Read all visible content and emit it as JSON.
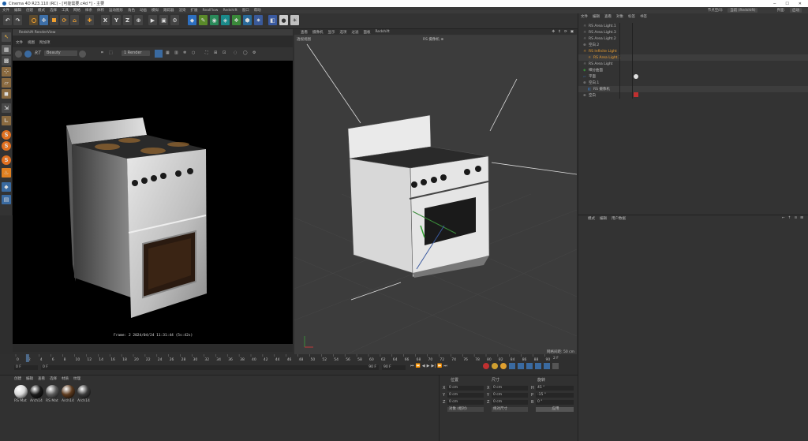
{
  "window": {
    "title": "Cinema 4D R23.110 (RC) - [可能需要.c4d *] - 主要"
  },
  "menubar": {
    "items": [
      "文件",
      "编辑",
      "创建",
      "模式",
      "选择",
      "工具",
      "网格",
      "样条",
      "体积",
      "运动图形",
      "角色",
      "动画",
      "模拟",
      "跟踪器",
      "渲染",
      "扩展",
      "RealFlow",
      "Redshift",
      "窗口",
      "帮助"
    ],
    "right": {
      "node_label": "节点空间:",
      "node_value": "当前 (Redshift)",
      "layout_label": "界面:",
      "layout_value": "启动"
    }
  },
  "toolbar": {
    "labels": [
      "X",
      "Y",
      "Z"
    ]
  },
  "renderview": {
    "title": "Redshift RenderView",
    "menu": [
      "文件",
      "视图",
      "附加项"
    ],
    "rt_label": "RT",
    "beauty": "Beauty",
    "camera": "1 Render",
    "status": "Frame: 2  2024/04/24  11:31:44  (5s:42s)"
  },
  "viewport": {
    "menu": [
      "查看",
      "摄像机",
      "显示",
      "选项",
      "过滤",
      "面板",
      "Redshift"
    ],
    "view_name": "透视视图",
    "camera_tag": "RS 摄像机 ⊕",
    "grid_spacing": "网格间距: 50 cm"
  },
  "objects": {
    "menu": [
      "文件",
      "编辑",
      "查看",
      "对象",
      "标签",
      "书签"
    ],
    "rows": [
      {
        "name": "RS Area Light.1",
        "color": "#c8c8c8"
      },
      {
        "name": "RS Area Light.3",
        "color": "#c8c8c8"
      },
      {
        "name": "RS Area Light.2",
        "color": "#c8c8c8"
      },
      {
        "name": "空白.2",
        "color": "#c8c8c8"
      },
      {
        "name": "RS Infinite Light",
        "color": "#f0a030"
      },
      {
        "name": "RS Area Light.1",
        "color": "#f0a030"
      },
      {
        "name": "RS Area Light",
        "color": "#c8c8c8"
      },
      {
        "name": "细分曲面",
        "color": "#c8c8c8"
      },
      {
        "name": "平面",
        "color": "#c8c8c8"
      },
      {
        "name": "空白.1",
        "color": "#c8c8c8"
      },
      {
        "name": "RS 摄像机",
        "color": "#c8c8c8"
      },
      {
        "name": "空白",
        "color": "#c8c8c8"
      }
    ]
  },
  "attributes": {
    "menu": [
      "模式",
      "编辑",
      "用户数据"
    ]
  },
  "timeline": {
    "ticks": [
      "0",
      "2",
      "4",
      "6",
      "8",
      "10",
      "12",
      "14",
      "16",
      "18",
      "20",
      "22",
      "24",
      "26",
      "28",
      "30",
      "32",
      "34",
      "36",
      "38",
      "40",
      "42",
      "44",
      "46",
      "48",
      "50",
      "52",
      "54",
      "56",
      "58",
      "60",
      "62",
      "64",
      "66",
      "68",
      "70",
      "72",
      "74",
      "76",
      "78",
      "80",
      "82",
      "84",
      "86",
      "88",
      "90"
    ],
    "current": "2 F",
    "start": "0 F",
    "start2": "0 F",
    "end": "90 F",
    "end2": "90 F"
  },
  "materials": {
    "menu": [
      "创建",
      "编辑",
      "查看",
      "选择",
      "材质",
      "纹理"
    ],
    "items": [
      {
        "label": "RS Mat",
        "color": "#d8d8d8"
      },
      {
        "label": "Arch14",
        "color": "#1a1a1a"
      },
      {
        "label": "RS Mat",
        "color": "#5a5a5a"
      },
      {
        "label": "Arch14",
        "color": "#5c3a1e"
      },
      {
        "label": "Arch14",
        "color": "#3a3a3a"
      }
    ]
  },
  "coords": {
    "headers": [
      "位置",
      "尺寸",
      "旋转"
    ],
    "rows": [
      {
        "axis": "X",
        "pos": "0 cm",
        "size": "0 cm",
        "rot_label": "H",
        "rot": "45 °"
      },
      {
        "axis": "Y",
        "pos": "0 cm",
        "size": "0 cm",
        "rot_label": "P",
        "rot": "-15 °"
      },
      {
        "axis": "Z",
        "pos": "0 cm",
        "size": "0 cm",
        "rot_label": "B",
        "rot": "0 °"
      }
    ],
    "mode": "对象 (相对)",
    "size_mode": "绝对尺寸",
    "apply": "应用"
  },
  "colors": {
    "accent": "#e8a020",
    "selection": "#4d6a8a",
    "render_bg": "#000000"
  }
}
